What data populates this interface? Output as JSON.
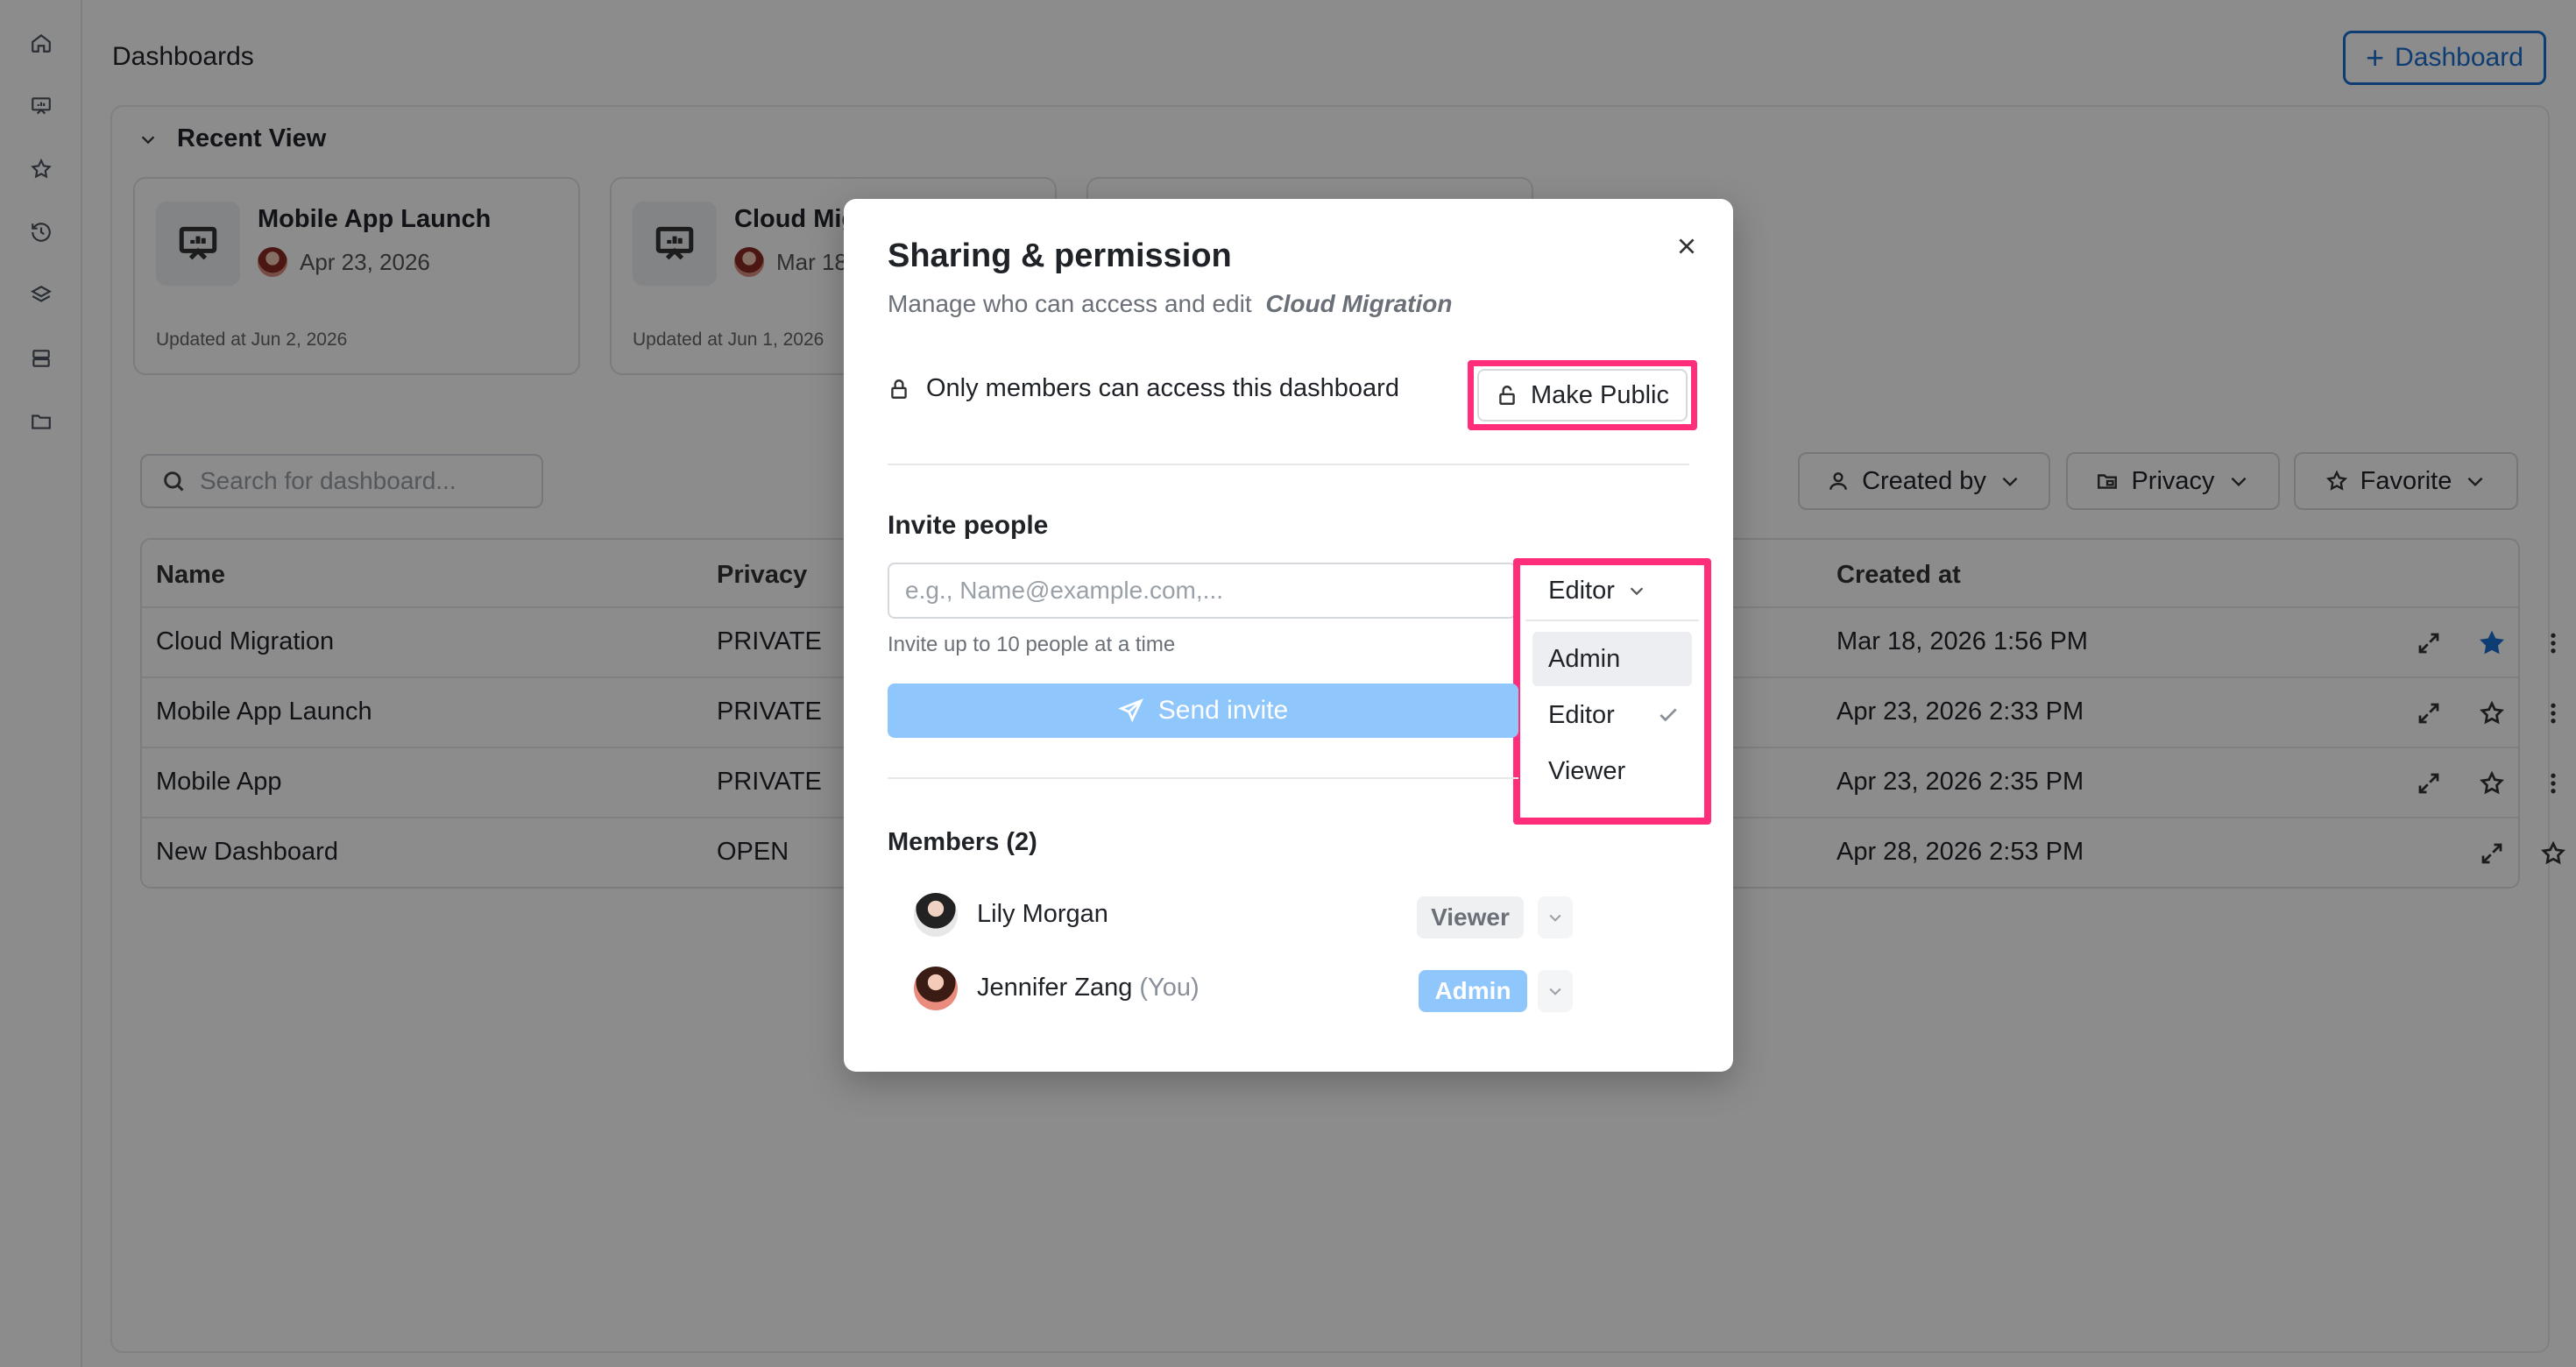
{
  "header": {
    "title": "Dashboards",
    "new_button": "Dashboard"
  },
  "rail": {
    "icons": [
      "home-icon",
      "presentation-icon",
      "star-icon",
      "history-icon",
      "layers-icon",
      "database-icon",
      "folder-icon"
    ]
  },
  "recent": {
    "heading": "Recent View",
    "cards": [
      {
        "title": "Mobile App Launch",
        "date": "Apr 23, 2026",
        "updated": "Updated at Jun 2, 2026"
      },
      {
        "title": "Cloud Mig",
        "date": "Mar 18",
        "updated": "Updated at Jun 1, 2026"
      }
    ]
  },
  "search": {
    "placeholder": "Search for dashboard..."
  },
  "filters": {
    "created_by": "Created by",
    "privacy": "Privacy",
    "favorite": "Favorite"
  },
  "table": {
    "headers": {
      "name": "Name",
      "privacy": "Privacy",
      "created_at": "Created at"
    },
    "rows": [
      {
        "name": "Cloud Migration",
        "privacy": "PRIVATE",
        "created": "Mar 18, 2026 1:56 PM",
        "favorite": true
      },
      {
        "name": "Mobile App Launch",
        "privacy": "PRIVATE",
        "created": "Apr 23, 2026 2:33 PM",
        "favorite": false
      },
      {
        "name": "Mobile App",
        "privacy": "PRIVATE",
        "created": "Apr 23, 2026 2:35 PM",
        "favorite": false
      },
      {
        "name": "New Dashboard",
        "privacy": "OPEN",
        "created": "Apr 28, 2026 2:53 PM",
        "favorite": false
      }
    ]
  },
  "modal": {
    "title": "Sharing & permission",
    "subtitle": "Manage who can access and edit",
    "dashboard_name": "Cloud Migration",
    "access_text": "Only members can access this dashboard",
    "make_public": "Make Public",
    "invite_label": "Invite people",
    "invite_placeholder": "e.g., Name@example.com,...",
    "invite_hint": "Invite up to 10 people at a time",
    "send_invite": "Send invite",
    "role_selected": "Editor",
    "role_options": [
      "Admin",
      "Editor",
      "Viewer"
    ],
    "members_label": "Members (2)",
    "members": [
      {
        "name": "Lily Morgan",
        "suffix": "",
        "role": "Viewer"
      },
      {
        "name": "Jennifer Zang",
        "suffix": "(You)",
        "role": "Admin"
      }
    ]
  },
  "colors": {
    "accent": "#1b6fd1",
    "highlight": "#ff2d7a",
    "send_button": "#8fc6fb",
    "overlay": "rgba(0,0,0,0.45)"
  }
}
